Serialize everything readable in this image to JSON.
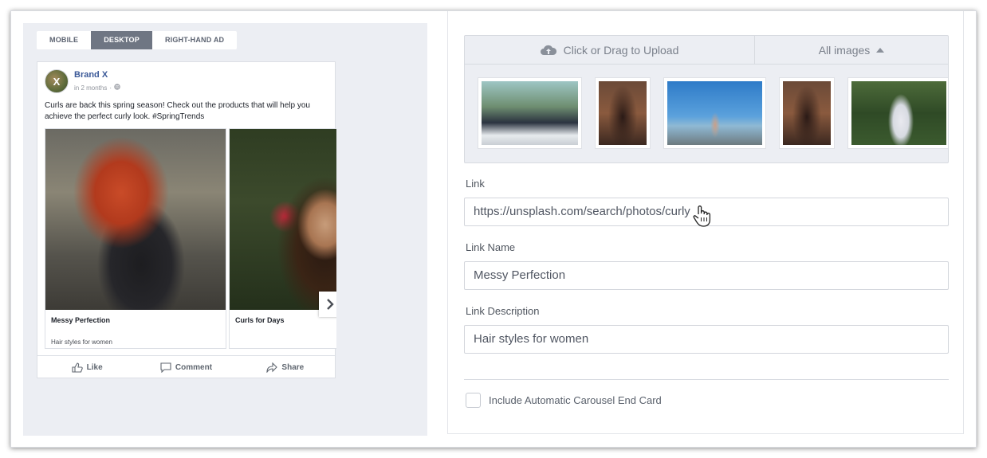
{
  "preview": {
    "tabs": [
      {
        "label": "MOBILE",
        "active": false
      },
      {
        "label": "DESKTOP",
        "active": true
      },
      {
        "label": "RIGHT-HAND AD",
        "active": false
      }
    ],
    "post": {
      "brand": "Brand X",
      "avatar_initial": "X",
      "timestamp": "in 2 months",
      "separator": "·",
      "text": "Curls are back this spring season! Check out the products that will help you achieve the perfect curly look. #SpringTrends",
      "carousel": [
        {
          "title": "Messy Perfection",
          "description": "Hair styles for women"
        },
        {
          "title": "Curls for Days",
          "description": ""
        }
      ],
      "actions": {
        "like": "Like",
        "comment": "Comment",
        "share": "Share"
      }
    }
  },
  "form": {
    "upload_label": "Click or Drag to Upload",
    "filter_label": "All images",
    "link_label": "Link",
    "link_value": "https://unsplash.com/search/photos/curly",
    "link_name_label": "Link Name",
    "link_name_value": "Messy Perfection",
    "link_description_label": "Link Description",
    "link_description_value": "Hair styles for women",
    "end_card_label": "Include Automatic Carousel End Card",
    "end_card_checked": false
  },
  "colors": {
    "brand_link": "#3b5998",
    "active_tab": "#6f7683",
    "panel_bg": "#eceef3"
  }
}
